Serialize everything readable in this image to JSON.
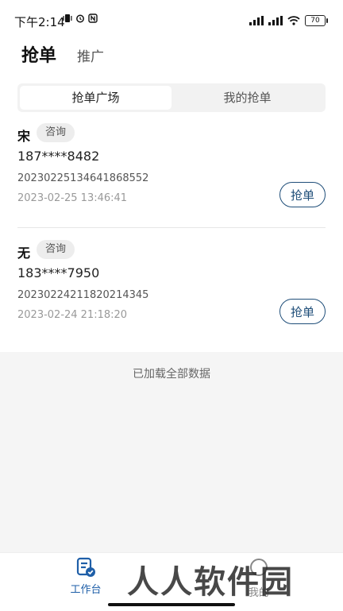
{
  "status_bar": {
    "time": "下午2:14",
    "battery": "70"
  },
  "header": {
    "tabs": [
      {
        "label": "抢单"
      },
      {
        "label": "推广"
      }
    ]
  },
  "segment": {
    "options": [
      {
        "label": "抢单广场"
      },
      {
        "label": "我的抢单"
      }
    ]
  },
  "orders": [
    {
      "name": "宋",
      "tag": "咨询",
      "phone": "187****8482",
      "order_no": "20230225134641868552",
      "time": "2023-02-25 13:46:41",
      "action_label": "抢单"
    },
    {
      "name": "无",
      "tag": "咨询",
      "phone": "183****7950",
      "order_no": "20230224211820214345",
      "time": "2023-02-24 21:18:20",
      "action_label": "抢单"
    }
  ],
  "list_footer": "已加载全部数据",
  "bottom_nav": {
    "items": [
      {
        "label": "工作台"
      },
      {
        "label": "我的"
      }
    ]
  },
  "watermark": "人人软件园",
  "colors": {
    "accent": "#1f4e79",
    "nav_active": "#1f5fa8"
  }
}
